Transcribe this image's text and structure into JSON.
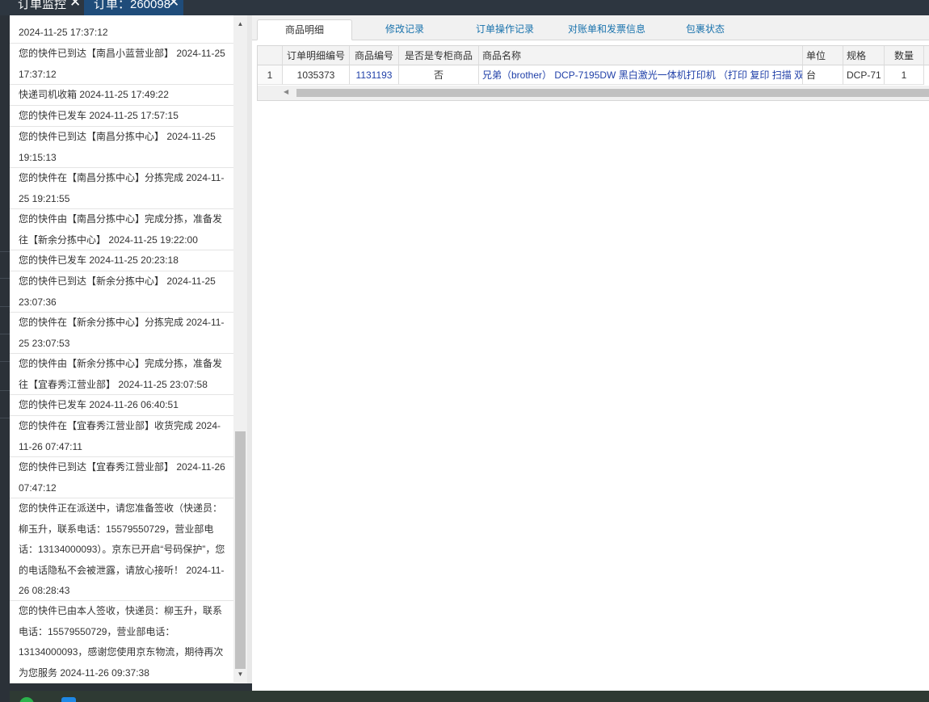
{
  "top_tabs": [
    {
      "label": "订单监控"
    },
    {
      "label": "订单：260098"
    }
  ],
  "logistics": [
    {
      "text": "2024-11-25 17:37:12"
    },
    {
      "text": "您的快件已到达【南昌小蓝营业部】 2024-11-25 17:37:12"
    },
    {
      "text": "快递司机收箱 2024-11-25 17:49:22"
    },
    {
      "text": "您的快件已发车 2024-11-25 17:57:15"
    },
    {
      "text": "您的快件已到达【南昌分拣中心】 2024-11-25 19:15:13"
    },
    {
      "text": "您的快件在【南昌分拣中心】分拣完成 2024-11-25 19:21:55"
    },
    {
      "text": "您的快件由【南昌分拣中心】完成分拣，准备发往【新余分拣中心】 2024-11-25 19:22:00"
    },
    {
      "text": "您的快件已发车 2024-11-25 20:23:18"
    },
    {
      "text": "您的快件已到达【新余分拣中心】 2024-11-25 23:07:36"
    },
    {
      "text": "您的快件在【新余分拣中心】分拣完成 2024-11-25 23:07:53"
    },
    {
      "text": "您的快件由【新余分拣中心】完成分拣，准备发往【宜春秀江营业部】 2024-11-25 23:07:58"
    },
    {
      "text": "您的快件已发车 2024-11-26 06:40:51"
    },
    {
      "text": "您的快件在【宜春秀江营业部】收货完成 2024-11-26 07:47:11"
    },
    {
      "text": "您的快件已到达【宜春秀江营业部】 2024-11-26 07:47:12"
    },
    {
      "text": "您的快件正在派送中，请您准备签收（快递员：柳玉升，联系电话：15579550729，营业部电话：13134000093）。京东已开启“号码保护”，您的电话隐私不会被泄露，请放心接听！ 2024-11-26 08:28:43"
    },
    {
      "text": "您的快件已由本人签收，快递员：柳玉升，联系电话：15579550729，营业部电话：13134000093，感谢您使用京东物流，期待再次为您服务 2024-11-26 09:37:38"
    }
  ],
  "content_tabs": [
    {
      "label": "商品明细",
      "active": true
    },
    {
      "label": "修改记录"
    },
    {
      "label": "订单操作记录"
    },
    {
      "label": "对账单和发票信息"
    },
    {
      "label": "包裹状态"
    }
  ],
  "table": {
    "headers": [
      "",
      "订单明细编号",
      "商品编号",
      "是否是专柜商品",
      "商品名称",
      "单位",
      "规格",
      "数量"
    ],
    "rows": [
      [
        "1",
        "1035373",
        "1131193",
        "否",
        "兄弟（brother） DCP-7195DW 黑白激光一体机打印机 （打印 复印 扫描 双",
        "台",
        "DCP-71",
        "1"
      ]
    ]
  },
  "colors": {
    "top_bar": "#2d3640",
    "active_top_tab": "#1f4c7a",
    "link": "#1f3fa8",
    "tab_link": "#1a73ad"
  }
}
